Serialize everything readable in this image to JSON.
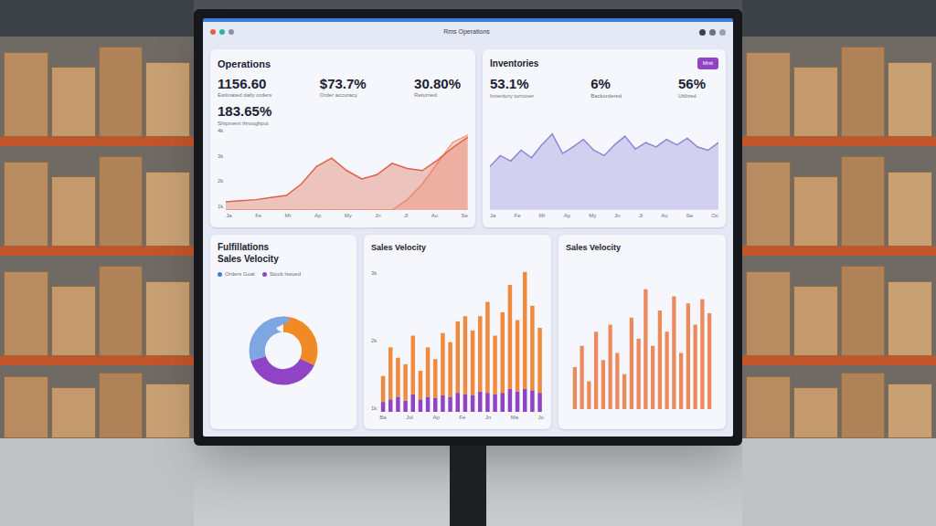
{
  "window": {
    "title": "Rms Operations"
  },
  "operations": {
    "title": "Operations",
    "stats": [
      {
        "value": "1156.60",
        "label": "Estimated daily orders"
      },
      {
        "value": "$73.7%",
        "label": "Order accuracy"
      },
      {
        "value": "30.80%",
        "label": "Returned"
      }
    ],
    "highlight": {
      "value": "183.65%",
      "label": "Shipment throughput"
    },
    "chart": {
      "y_ticks": [
        "4k",
        "3k",
        "2k",
        "1k"
      ],
      "x_ticks": [
        "Ja",
        "Fe",
        "Mr",
        "Ap",
        "My",
        "Jn",
        "Jl",
        "Au",
        "Se"
      ],
      "series": [
        {
          "name": "returns",
          "color": "#f3a07a",
          "values": [
            0,
            0,
            0,
            0,
            0,
            0,
            0,
            0,
            0,
            0,
            0,
            0,
            10,
            25,
            45,
            65,
            72
          ]
        },
        {
          "name": "orders",
          "color": "#e0604a",
          "values": [
            8,
            9,
            10,
            12,
            14,
            25,
            42,
            50,
            38,
            30,
            34,
            45,
            40,
            38,
            48,
            60,
            70
          ]
        }
      ]
    }
  },
  "inventory": {
    "title": "Inventories",
    "badge": "Mnti",
    "stats": [
      {
        "value": "53.1%",
        "label": "Inventory turnover"
      },
      {
        "value": "6%",
        "label": "Backordered"
      },
      {
        "value": "56%",
        "label": "Utilized"
      }
    ],
    "chart": {
      "x_ticks": [
        "Ja",
        "Fe",
        "Mr",
        "Ap",
        "My",
        "Jn",
        "Jl",
        "Au",
        "Se",
        "Oc"
      ],
      "series": [
        {
          "name": "stock",
          "color": "#8f86d8",
          "values": [
            40,
            50,
            45,
            55,
            48,
            60,
            70,
            52,
            58,
            65,
            55,
            50,
            60,
            68,
            56,
            62,
            58,
            65,
            60,
            66,
            58,
            55,
            62
          ]
        }
      ]
    }
  },
  "fulfillment": {
    "title": "Fulfillations",
    "subtitle": "Sales Velocity",
    "legend": [
      {
        "label": "Orders Goal",
        "color": "#3b7ddd"
      },
      {
        "label": "Stock Issued",
        "color": "#8e44c4"
      }
    ],
    "segments": [
      {
        "value": 32,
        "color": "#f08a24"
      },
      {
        "value": 38,
        "color": "#8e44c4"
      },
      {
        "value": 30,
        "color": "#7ea6e0"
      }
    ]
  },
  "velocity_a": {
    "title": "Sales Velocity",
    "y_ticks": [
      "3k",
      "2k",
      "1k"
    ],
    "x_ticks": [
      "Ba",
      "Jul",
      "Ap",
      "Fe",
      "Jn",
      "Ma",
      "Jo"
    ],
    "series": [
      {
        "name": "base",
        "color": "#8e44c4",
        "values": [
          8,
          10,
          12,
          9,
          14,
          10,
          12,
          11,
          13,
          12,
          15,
          14,
          13,
          16,
          15,
          14,
          15,
          18,
          16,
          18,
          17,
          15
        ]
      },
      {
        "name": "top",
        "color": "#f08a3c",
        "values": [
          20,
          40,
          30,
          28,
          45,
          22,
          38,
          30,
          48,
          42,
          55,
          60,
          50,
          58,
          70,
          45,
          62,
          80,
          55,
          90,
          65,
          50
        ]
      }
    ]
  },
  "velocity_b": {
    "title": "Sales Velocity",
    "series": [
      {
        "name": "sales",
        "color": "#ec8a5c",
        "values": [
          30,
          45,
          20,
          55,
          35,
          60,
          40,
          25,
          65,
          50,
          85,
          45,
          70,
          55,
          80,
          40,
          75,
          60,
          78,
          68
        ]
      }
    ]
  }
}
